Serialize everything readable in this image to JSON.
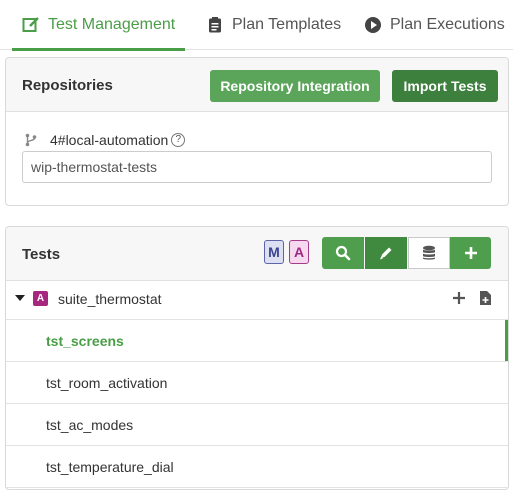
{
  "tabs": [
    {
      "label": "Test Management",
      "icon": "edit-icon",
      "active": true
    },
    {
      "label": "Plan Templates",
      "icon": "clipboard-icon",
      "active": false
    },
    {
      "label": "Plan Executions",
      "icon": "play-circle-icon",
      "active": false
    }
  ],
  "repositories": {
    "title": "Repositories",
    "integration_button": "Repository Integration",
    "import_button": "Import Tests",
    "branch_label": "4#local-automation",
    "help_glyph": "?",
    "branch_value": "wip-thermostat-tests"
  },
  "tests": {
    "title": "Tests",
    "badge_m": "M",
    "badge_a": "A",
    "suite": {
      "badge": "A",
      "name": "suite_thermostat"
    },
    "items": [
      {
        "name": "tst_screens",
        "selected": true
      },
      {
        "name": "tst_room_activation",
        "selected": false
      },
      {
        "name": "tst_ac_modes",
        "selected": false
      },
      {
        "name": "tst_temperature_dial",
        "selected": false
      }
    ]
  },
  "colors": {
    "accent": "#4a9e47",
    "dark_button": "#3d7f3d",
    "suite_badge": "#a6277e"
  }
}
